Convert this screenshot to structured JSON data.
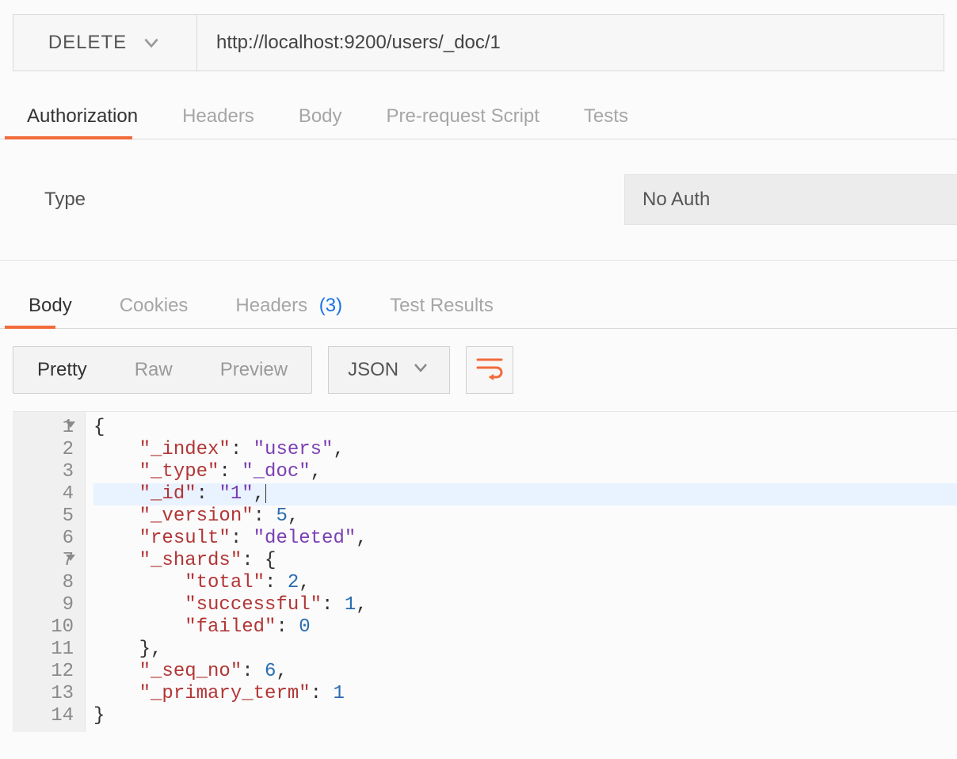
{
  "request": {
    "method": "DELETE",
    "url": "http://localhost:9200/users/_doc/1"
  },
  "request_tabs": {
    "items": [
      "Authorization",
      "Headers",
      "Body",
      "Pre-request Script",
      "Tests"
    ],
    "active_index": 0
  },
  "authorization": {
    "type_label": "Type",
    "selected_type": "No Auth"
  },
  "response_tabs": {
    "items": [
      {
        "label": "Body",
        "badge": null
      },
      {
        "label": "Cookies",
        "badge": null
      },
      {
        "label": "Headers",
        "badge": "(3)"
      },
      {
        "label": "Test Results",
        "badge": null
      }
    ],
    "active_index": 0
  },
  "view_controls": {
    "modes": [
      "Pretty",
      "Raw",
      "Preview"
    ],
    "active_mode_index": 0,
    "format": "JSON"
  },
  "response_body": {
    "highlighted_line": 4,
    "fold_lines": [
      1,
      7
    ],
    "lines": [
      {
        "n": 1,
        "indent": 0,
        "tokens": [
          {
            "t": "punc",
            "v": "{"
          }
        ]
      },
      {
        "n": 2,
        "indent": 1,
        "tokens": [
          {
            "t": "key",
            "v": "\"_index\""
          },
          {
            "t": "punc",
            "v": ": "
          },
          {
            "t": "str",
            "v": "\"users\""
          },
          {
            "t": "punc",
            "v": ","
          }
        ]
      },
      {
        "n": 3,
        "indent": 1,
        "tokens": [
          {
            "t": "key",
            "v": "\"_type\""
          },
          {
            "t": "punc",
            "v": ": "
          },
          {
            "t": "str",
            "v": "\"_doc\""
          },
          {
            "t": "punc",
            "v": ","
          }
        ]
      },
      {
        "n": 4,
        "indent": 1,
        "tokens": [
          {
            "t": "key",
            "v": "\"_id\""
          },
          {
            "t": "punc",
            "v": ": "
          },
          {
            "t": "str",
            "v": "\"1\""
          },
          {
            "t": "punc",
            "v": ","
          }
        ],
        "cursor_after": true
      },
      {
        "n": 5,
        "indent": 1,
        "tokens": [
          {
            "t": "key",
            "v": "\"_version\""
          },
          {
            "t": "punc",
            "v": ": "
          },
          {
            "t": "num",
            "v": "5"
          },
          {
            "t": "punc",
            "v": ","
          }
        ]
      },
      {
        "n": 6,
        "indent": 1,
        "tokens": [
          {
            "t": "key",
            "v": "\"result\""
          },
          {
            "t": "punc",
            "v": ": "
          },
          {
            "t": "str",
            "v": "\"deleted\""
          },
          {
            "t": "punc",
            "v": ","
          }
        ]
      },
      {
        "n": 7,
        "indent": 1,
        "tokens": [
          {
            "t": "key",
            "v": "\"_shards\""
          },
          {
            "t": "punc",
            "v": ": "
          },
          {
            "t": "punc",
            "v": "{"
          }
        ]
      },
      {
        "n": 8,
        "indent": 2,
        "tokens": [
          {
            "t": "key",
            "v": "\"total\""
          },
          {
            "t": "punc",
            "v": ": "
          },
          {
            "t": "num",
            "v": "2"
          },
          {
            "t": "punc",
            "v": ","
          }
        ]
      },
      {
        "n": 9,
        "indent": 2,
        "tokens": [
          {
            "t": "key",
            "v": "\"successful\""
          },
          {
            "t": "punc",
            "v": ": "
          },
          {
            "t": "num",
            "v": "1"
          },
          {
            "t": "punc",
            "v": ","
          }
        ]
      },
      {
        "n": 10,
        "indent": 2,
        "tokens": [
          {
            "t": "key",
            "v": "\"failed\""
          },
          {
            "t": "punc",
            "v": ": "
          },
          {
            "t": "num",
            "v": "0"
          }
        ]
      },
      {
        "n": 11,
        "indent": 1,
        "tokens": [
          {
            "t": "punc",
            "v": "},"
          }
        ]
      },
      {
        "n": 12,
        "indent": 1,
        "tokens": [
          {
            "t": "key",
            "v": "\"_seq_no\""
          },
          {
            "t": "punc",
            "v": ": "
          },
          {
            "t": "num",
            "v": "6"
          },
          {
            "t": "punc",
            "v": ","
          }
        ]
      },
      {
        "n": 13,
        "indent": 1,
        "tokens": [
          {
            "t": "key",
            "v": "\"_primary_term\""
          },
          {
            "t": "punc",
            "v": ": "
          },
          {
            "t": "num",
            "v": "1"
          }
        ]
      },
      {
        "n": 14,
        "indent": 0,
        "tokens": [
          {
            "t": "punc",
            "v": "}"
          }
        ]
      }
    ]
  }
}
